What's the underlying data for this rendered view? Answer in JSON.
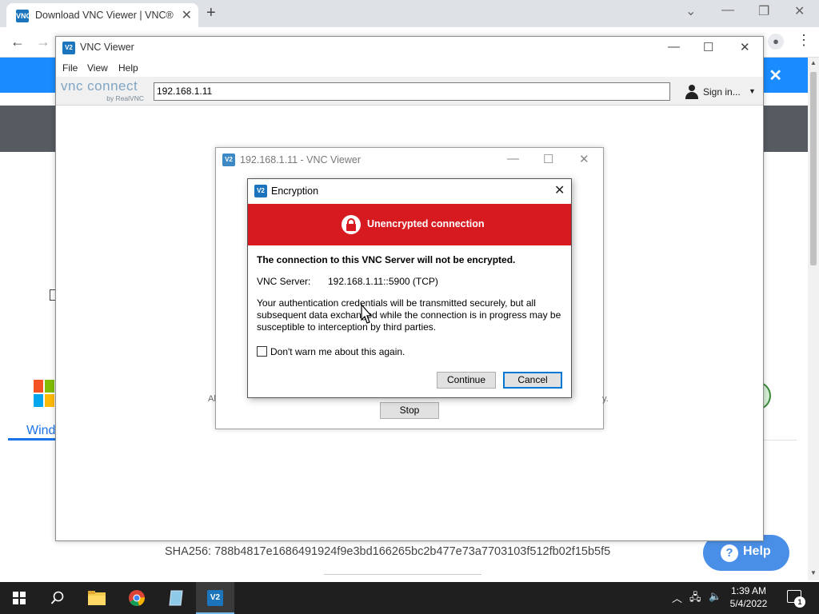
{
  "browser": {
    "tab_title": "Download VNC Viewer | VNC® C",
    "new_tab": "+",
    "tab_favicon": "VNC"
  },
  "page": {
    "sha": "SHA256: 788b4817e1686491924f9e3bd166265bc2b477e73a7703103f512fb02f15b5f5",
    "windows_label": "Wind",
    "help_label": "Help",
    "banner_close": "✕"
  },
  "vnc_viewer": {
    "title": "VNC Viewer",
    "menu": [
      "File",
      "View",
      "Help"
    ],
    "logo_main": "vnc connect",
    "logo_by": "by RealVNC",
    "address": "192.168.1.11",
    "sign_in": "Sign in..."
  },
  "session": {
    "title": "192.168.1.11 - VNC Viewer",
    "left_fragment": "Al",
    "right_fragment": "y.",
    "stop_label": "Stop"
  },
  "encryption_dialog": {
    "title": "Encryption",
    "banner_title": "Unencrypted connection",
    "heading": "The connection to this VNC Server will not be encrypted.",
    "server_label": "VNC Server:",
    "server_value": "192.168.1.11::5900 (TCP)",
    "body": "Your authentication credentials will be transmitted securely, but all subsequent data exchanged while the connection is in progress may be susceptible to interception by third parties.",
    "checkbox_label": "Don't warn me about this again.",
    "checkbox_checked": false,
    "continue_label": "Continue",
    "cancel_label": "Cancel",
    "banner_color": "#d71920"
  },
  "taskbar": {
    "time": "1:39 AM",
    "date": "5/4/2022",
    "notification_count": "1"
  },
  "colors": {
    "accent": "#1c75bc",
    "site_banner": "#1a8cff",
    "help_button": "#4a8fe7"
  }
}
